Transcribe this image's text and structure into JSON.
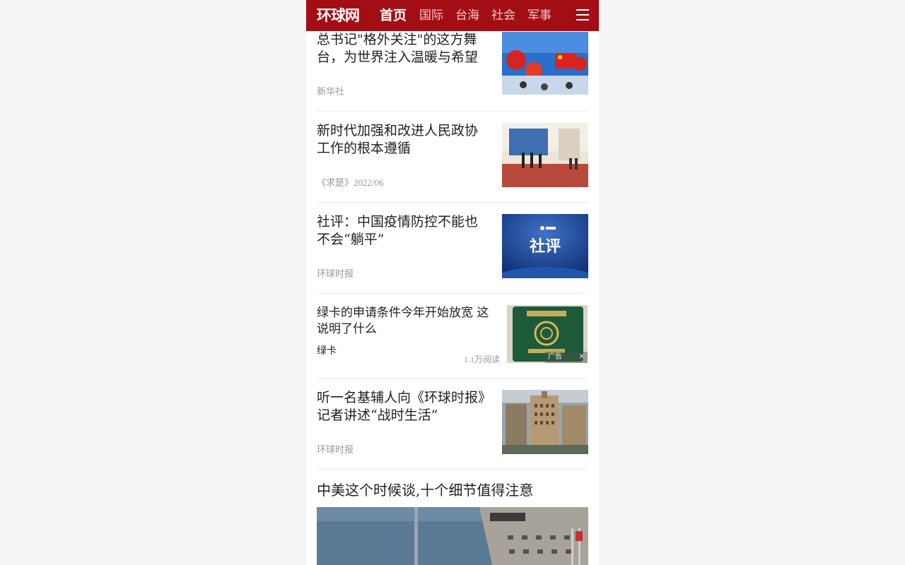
{
  "header": {
    "logo": "环球网",
    "nav": [
      "首页",
      "国际",
      "台海",
      "社会",
      "军事"
    ],
    "menu_icon": "hamburger-menu-icon",
    "brand_color": "#a30e15"
  },
  "articles": [
    {
      "title": "总书记\"格外关注\"的这方舞台，为世界注入温暖与希望",
      "source": "新华社"
    },
    {
      "title": "新时代加强和改进人民政协工作的根本遵循",
      "source": "《求是》2022/06"
    },
    {
      "title": "社评：中国疫情防控不能也不会“躺平”",
      "source": "环球时报",
      "thumb_text": "社评"
    },
    {
      "title": "听一名基辅人向《环球时报》记者讲述“战时生活”",
      "source": "环球时报"
    }
  ],
  "ad": {
    "title": "绿卡的申请条件今年开始放宽 这说明了什么",
    "tag": "绿卡",
    "reads": "1.1万阅读",
    "badge": "广告",
    "close": "✕"
  },
  "big_article": {
    "title": "中美这个时候谈,十个细节值得注意"
  }
}
